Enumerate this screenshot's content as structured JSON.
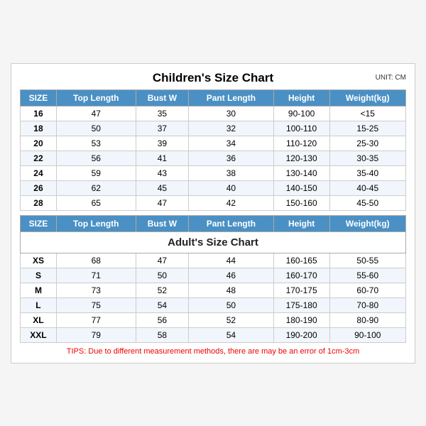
{
  "title": "Children's Size Chart",
  "unit": "UNIT: CM",
  "children_headers": [
    "SIZE",
    "Top Length",
    "Bust W",
    "Pant Length",
    "Height",
    "Weight(kg)"
  ],
  "children_rows": [
    [
      "16",
      "47",
      "35",
      "30",
      "90-100",
      "<15"
    ],
    [
      "18",
      "50",
      "37",
      "32",
      "100-110",
      "15-25"
    ],
    [
      "20",
      "53",
      "39",
      "34",
      "110-120",
      "25-30"
    ],
    [
      "22",
      "56",
      "41",
      "36",
      "120-130",
      "30-35"
    ],
    [
      "24",
      "59",
      "43",
      "38",
      "130-140",
      "35-40"
    ],
    [
      "26",
      "62",
      "45",
      "40",
      "140-150",
      "40-45"
    ],
    [
      "28",
      "65",
      "47",
      "42",
      "150-160",
      "45-50"
    ]
  ],
  "adult_section_title": "Adult's Size Chart",
  "adult_headers": [
    "SIZE",
    "Top Length",
    "Bust W",
    "Pant Length",
    "Height",
    "Weight(kg)"
  ],
  "adult_rows": [
    [
      "XS",
      "68",
      "47",
      "44",
      "160-165",
      "50-55"
    ],
    [
      "S",
      "71",
      "50",
      "46",
      "160-170",
      "55-60"
    ],
    [
      "M",
      "73",
      "52",
      "48",
      "170-175",
      "60-70"
    ],
    [
      "L",
      "75",
      "54",
      "50",
      "175-180",
      "70-80"
    ],
    [
      "XL",
      "77",
      "56",
      "52",
      "180-190",
      "80-90"
    ],
    [
      "XXL",
      "79",
      "58",
      "54",
      "190-200",
      "90-100"
    ]
  ],
  "tips": "TIPS: Due to different measurement methods, there are may be an error of 1cm-3cm"
}
